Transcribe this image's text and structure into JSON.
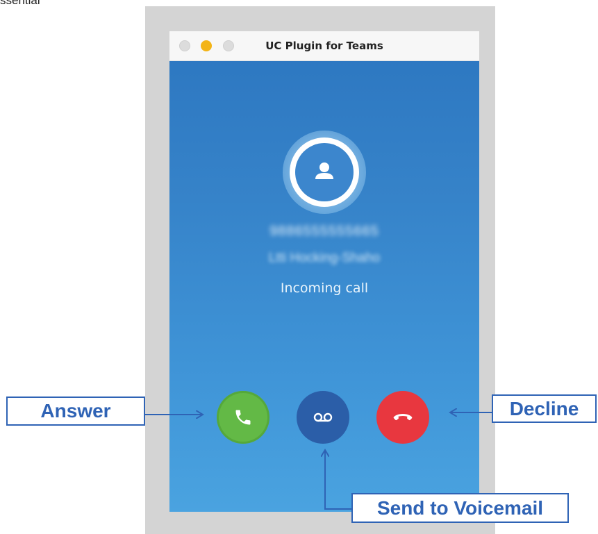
{
  "page": {
    "cropped_text": "ssential"
  },
  "window": {
    "title": "UC Plugin for Teams",
    "controls": [
      "close",
      "minimize",
      "maximize"
    ]
  },
  "call": {
    "caller_number": "9886555555665",
    "caller_name": "Ltti Hocking-Shaho",
    "status": "Incoming call"
  },
  "buttons": {
    "answer": {
      "icon": "phone-icon",
      "color": "#63b946"
    },
    "voicemail": {
      "icon": "voicemail-icon",
      "color": "#2b5ea8"
    },
    "decline": {
      "icon": "hang-up-icon",
      "color": "#e8373f"
    }
  },
  "callouts": {
    "answer": "Answer",
    "decline": "Decline",
    "voicemail": "Send to Voicemail",
    "color": "#2f63b5"
  }
}
